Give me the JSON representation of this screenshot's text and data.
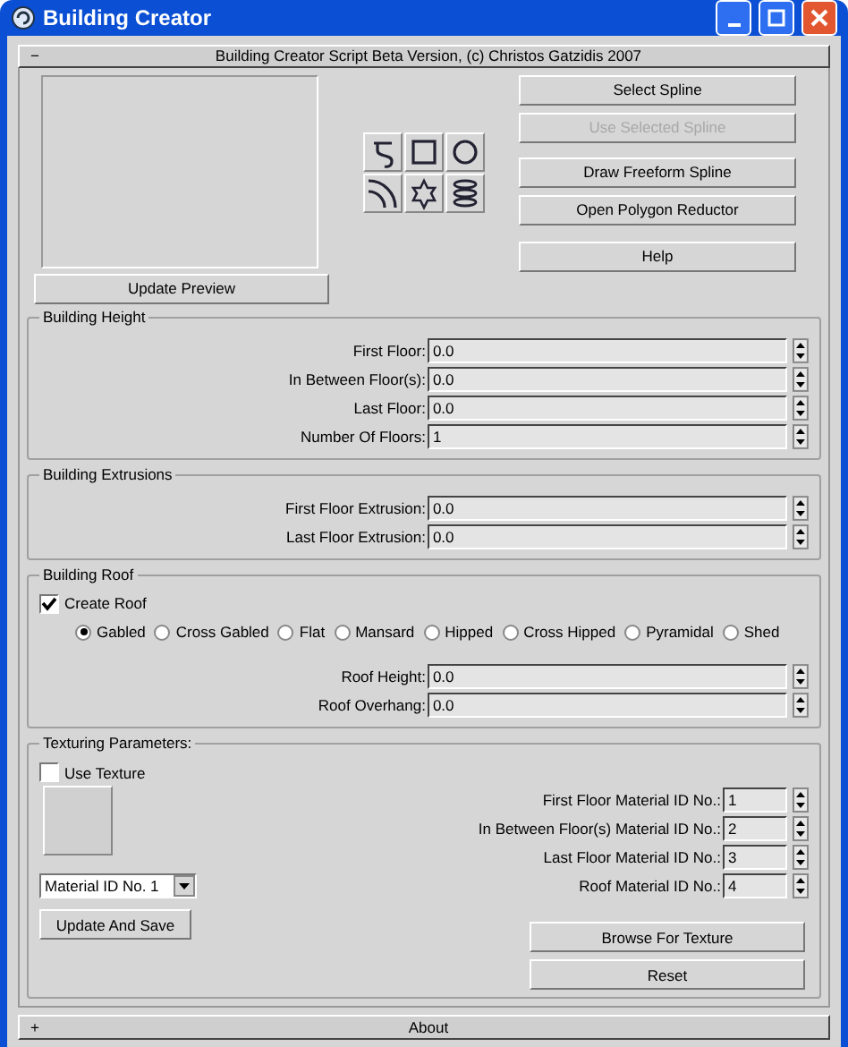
{
  "window": {
    "title": "Building Creator"
  },
  "rollout": {
    "symbol": "−",
    "title": "Building Creator Script Beta Version, (c) Christos Gatzidis 2007"
  },
  "preview_button": "Update Preview",
  "actions": [
    {
      "label": "Select Spline",
      "disabled": false
    },
    {
      "label": "Use Selected Spline",
      "disabled": true
    },
    {
      "label": "Draw Freeform Spline",
      "disabled": false
    },
    {
      "label": "Open Polygon Reductor",
      "disabled": false
    },
    {
      "label": "Help",
      "disabled": false
    }
  ],
  "building_height": {
    "title": "Building Height",
    "fields": [
      {
        "label": "First Floor:",
        "value": "0.0"
      },
      {
        "label": "In Between Floor(s):",
        "value": "0.0"
      },
      {
        "label": "Last Floor:",
        "value": "0.0"
      },
      {
        "label": "Number Of Floors:",
        "value": "1"
      }
    ]
  },
  "building_extrusions": {
    "title": "Building Extrusions",
    "fields": [
      {
        "label": "First Floor Extrusion:",
        "value": "0.0"
      },
      {
        "label": "Last Floor Extrusion:",
        "value": "0.0"
      }
    ]
  },
  "building_roof": {
    "title": "Building Roof",
    "create_roof": {
      "label": "Create Roof",
      "checked": true
    },
    "roof_types": [
      {
        "label": "Gabled",
        "selected": true
      },
      {
        "label": "Cross Gabled",
        "selected": false
      },
      {
        "label": "Flat",
        "selected": false
      },
      {
        "label": "Mansard",
        "selected": false
      },
      {
        "label": "Hipped",
        "selected": false
      },
      {
        "label": "Cross Hipped",
        "selected": false
      },
      {
        "label": "Pyramidal",
        "selected": false
      },
      {
        "label": "Shed",
        "selected": false
      }
    ],
    "fields": [
      {
        "label": "Roof Height:",
        "value": "0.0"
      },
      {
        "label": "Roof Overhang:",
        "value": "0.0"
      }
    ]
  },
  "texturing": {
    "title": "Texturing Parameters:",
    "use_texture": {
      "label": "Use Texture",
      "checked": false
    },
    "material_dropdown": {
      "value": "Material ID No. 1"
    },
    "update_button": "Update And Save",
    "fields": [
      {
        "label": "First Floor Material ID No.:",
        "value": "1"
      },
      {
        "label": "In Between Floor(s) Material ID No.:",
        "value": "2"
      },
      {
        "label": "Last Floor Material ID No.:",
        "value": "3"
      },
      {
        "label": "Roof Material ID No.:",
        "value": "4"
      }
    ],
    "buttons": [
      "Browse For Texture",
      "Reset"
    ]
  },
  "about": {
    "symbol": "+",
    "title": "About"
  }
}
